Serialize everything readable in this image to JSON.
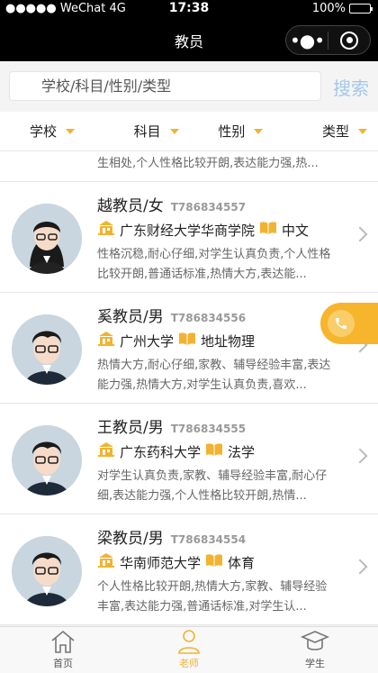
{
  "status_bar": {
    "carrier": "●●●●● WeChat 4G",
    "time": "17:38",
    "battery": "100%"
  },
  "nav": {
    "title": "教员"
  },
  "search": {
    "placeholder": "学校/科目/性别/类型",
    "button": "搜索"
  },
  "filters": [
    "学校",
    "科目",
    "性别",
    "类型"
  ],
  "partial_item": {
    "desc": "生相处,个人性格比较开朗,表达能力强,热..."
  },
  "teachers": [
    {
      "name": "越教员/女",
      "id": "T786834557",
      "school": "广东财经大学华商学院",
      "subject": "中文",
      "gender": "female",
      "desc": "性格沉稳,耐心仔细,对学生认真负责,个人性格比较开朗,普通话标准,热情大方,表达能..."
    },
    {
      "name": "奚教员/男",
      "id": "T786834556",
      "school": "广州大学",
      "subject": "地址物理",
      "gender": "male",
      "desc": "热情大方,耐心仔细,家教、辅导经验丰富,表达能力强,热情大方,对学生认真负责,喜欢..."
    },
    {
      "name": "王教员/男",
      "id": "T786834555",
      "school": "广东药科大学",
      "subject": "法学",
      "gender": "male",
      "desc": "对学生认真负责,家教、辅导经验丰富,耐心仔细,表达能力强,个人性格比较开朗,热情..."
    },
    {
      "name": "梁教员/男",
      "id": "T786834554",
      "school": "华南师范大学",
      "subject": "体育",
      "gender": "male",
      "desc": "个人性格比较开朗,热情大方,家教、辅导经验丰富,表达能力强,普通话标准,对学生认..."
    }
  ],
  "tabbar": [
    {
      "label": "首页",
      "icon": "home-icon",
      "active": false
    },
    {
      "label": "老师",
      "icon": "teacher-icon",
      "active": true
    },
    {
      "label": "学生",
      "icon": "student-cap-icon",
      "active": false
    }
  ],
  "colors": {
    "accent": "#f2b330",
    "search_button": "#a5c7e8"
  }
}
